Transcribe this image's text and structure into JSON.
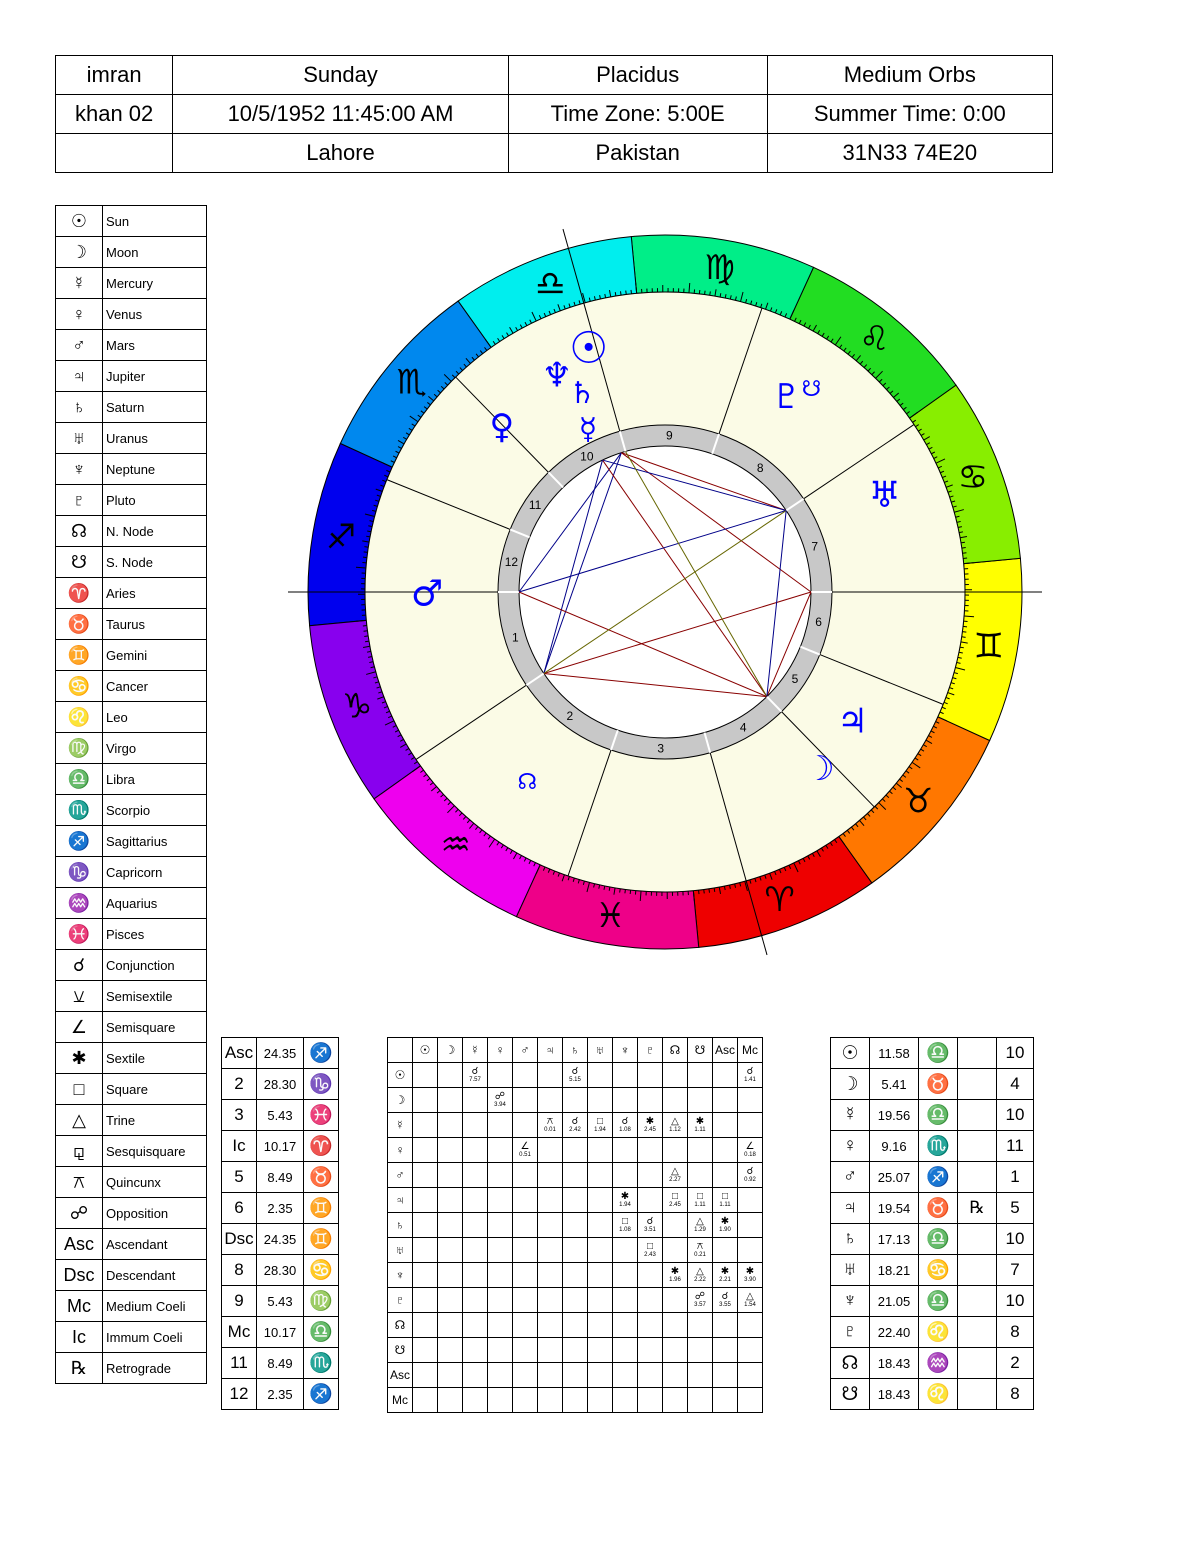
{
  "header": {
    "rows": [
      [
        "imran",
        "Sunday",
        "Placidus",
        "Medium Orbs"
      ],
      [
        "khan 02",
        "10/5/1952 11:45:00 AM",
        "Time Zone: 5:00E",
        "Summer Time: 0:00"
      ],
      [
        "",
        "Lahore",
        "Pakistan",
        "31N33 74E20"
      ]
    ]
  },
  "legend": [
    {
      "glyph": "☉",
      "label": "Sun"
    },
    {
      "glyph": "☽",
      "label": "Moon"
    },
    {
      "glyph": "☿",
      "label": "Mercury"
    },
    {
      "glyph": "♀",
      "label": "Venus"
    },
    {
      "glyph": "♂",
      "label": "Mars"
    },
    {
      "glyph": "♃",
      "label": "Jupiter"
    },
    {
      "glyph": "♄",
      "label": "Saturn"
    },
    {
      "glyph": "♅",
      "label": "Uranus"
    },
    {
      "glyph": "♆",
      "label": "Neptune"
    },
    {
      "glyph": "♇",
      "label": "Pluto"
    },
    {
      "glyph": "☊",
      "label": "N. Node"
    },
    {
      "glyph": "☋",
      "label": "S. Node"
    },
    {
      "glyph": "♈",
      "label": "Aries"
    },
    {
      "glyph": "♉",
      "label": "Taurus"
    },
    {
      "glyph": "♊",
      "label": "Gemini"
    },
    {
      "glyph": "♋",
      "label": "Cancer"
    },
    {
      "glyph": "♌",
      "label": "Leo"
    },
    {
      "glyph": "♍",
      "label": "Virgo"
    },
    {
      "glyph": "♎",
      "label": "Libra"
    },
    {
      "glyph": "♏",
      "label": "Scorpio"
    },
    {
      "glyph": "♐",
      "label": "Sagittarius"
    },
    {
      "glyph": "♑",
      "label": "Capricorn"
    },
    {
      "glyph": "♒",
      "label": "Aquarius"
    },
    {
      "glyph": "♓",
      "label": "Pisces"
    },
    {
      "glyph": "☌",
      "label": "Conjunction"
    },
    {
      "glyph": "⚺",
      "label": "Semisextile"
    },
    {
      "glyph": "∠",
      "label": "Semisquare"
    },
    {
      "glyph": "✱",
      "label": "Sextile"
    },
    {
      "glyph": "□",
      "label": "Square"
    },
    {
      "glyph": "△",
      "label": "Trine"
    },
    {
      "glyph": "⚼",
      "label": "Sesquisquare"
    },
    {
      "glyph": "⚻",
      "label": "Quincunx"
    },
    {
      "glyph": "☍",
      "label": "Opposition"
    },
    {
      "glyph": "Asc",
      "label": "Ascendant"
    },
    {
      "glyph": "Dsc",
      "label": "Descendant"
    },
    {
      "glyph": "Mc",
      "label": "Medium Coeli"
    },
    {
      "glyph": "Ic",
      "label": "Immum Coeli"
    },
    {
      "glyph": "℞",
      "label": "Retrograde"
    }
  ],
  "houses": [
    {
      "h": "Asc",
      "deg": "24.35",
      "sign": "♐"
    },
    {
      "h": "2",
      "deg": "28.30",
      "sign": "♑"
    },
    {
      "h": "3",
      "deg": "5.43",
      "sign": "♓"
    },
    {
      "h": "Ic",
      "deg": "10.17",
      "sign": "♈"
    },
    {
      "h": "5",
      "deg": "8.49",
      "sign": "♉"
    },
    {
      "h": "6",
      "deg": "2.35",
      "sign": "♊"
    },
    {
      "h": "Dsc",
      "deg": "24.35",
      "sign": "♊"
    },
    {
      "h": "8",
      "deg": "28.30",
      "sign": "♋"
    },
    {
      "h": "9",
      "deg": "5.43",
      "sign": "♍"
    },
    {
      "h": "Mc",
      "deg": "10.17",
      "sign": "♎"
    },
    {
      "h": "11",
      "deg": "8.49",
      "sign": "♏"
    },
    {
      "h": "12",
      "deg": "2.35",
      "sign": "♐"
    }
  ],
  "aspect_grid": {
    "columns": [
      "☉",
      "☽",
      "☿",
      "♀",
      "♂",
      "♃",
      "♄",
      "♅",
      "♆",
      "♇",
      "☊",
      "☋",
      "Asc",
      "Mc"
    ],
    "rows": [
      "☉",
      "☽",
      "☿",
      "♀",
      "♂",
      "♃",
      "♄",
      "♅",
      "♆",
      "♇",
      "☊",
      "☋",
      "Asc",
      "Mc"
    ],
    "cells": [
      {
        "r": 0,
        "c": 2,
        "g": "☌",
        "o": "7.57"
      },
      {
        "r": 0,
        "c": 6,
        "g": "☌",
        "o": "5.15"
      },
      {
        "r": 0,
        "c": 13,
        "g": "☌",
        "o": "1.41"
      },
      {
        "r": 1,
        "c": 3,
        "g": "☍",
        "o": "3.94"
      },
      {
        "r": 2,
        "c": 5,
        "g": "⚻",
        "o": "0.01"
      },
      {
        "r": 2,
        "c": 6,
        "g": "☌",
        "o": "2.42"
      },
      {
        "r": 2,
        "c": 7,
        "g": "□",
        "o": "1.94"
      },
      {
        "r": 2,
        "c": 8,
        "g": "☌",
        "o": "1.08"
      },
      {
        "r": 2,
        "c": 9,
        "g": "✱",
        "o": "2.45"
      },
      {
        "r": 2,
        "c": 10,
        "g": "△",
        "o": "1.12"
      },
      {
        "r": 2,
        "c": 11,
        "g": "✱",
        "o": "1.11"
      },
      {
        "r": 3,
        "c": 4,
        "g": "∠",
        "o": "0.51"
      },
      {
        "r": 3,
        "c": 13,
        "g": "∠",
        "o": "0.18"
      },
      {
        "r": 4,
        "c": 10,
        "g": "△",
        "o": "2.27"
      },
      {
        "r": 4,
        "c": 13,
        "g": "☌",
        "o": "0.92"
      },
      {
        "r": 5,
        "c": 8,
        "g": "✱",
        "o": "1.94"
      },
      {
        "r": 5,
        "c": 10,
        "g": "□",
        "o": "2.45"
      },
      {
        "r": 5,
        "c": 11,
        "g": "□",
        "o": "1.11"
      },
      {
        "r": 5,
        "c": 12,
        "g": "□",
        "o": "1.11"
      },
      {
        "r": 6,
        "c": 8,
        "g": "□",
        "o": "1.08"
      },
      {
        "r": 6,
        "c": 9,
        "g": "☌",
        "o": "3.51"
      },
      {
        "r": 6,
        "c": 11,
        "g": "△",
        "o": "1.29"
      },
      {
        "r": 6,
        "c": 12,
        "g": "✱",
        "o": "1.90"
      },
      {
        "r": 7,
        "c": 9,
        "g": "□",
        "o": "2.43"
      },
      {
        "r": 7,
        "c": 11,
        "g": "⚻",
        "o": "0.21"
      },
      {
        "r": 8,
        "c": 10,
        "g": "✱",
        "o": "1.96"
      },
      {
        "r": 8,
        "c": 11,
        "g": "△",
        "o": "2.22"
      },
      {
        "r": 8,
        "c": 12,
        "g": "✱",
        "o": "2.21"
      },
      {
        "r": 8,
        "c": 13,
        "g": "✱",
        "o": "3.90"
      },
      {
        "r": 9,
        "c": 11,
        "g": "☍",
        "o": "3.57"
      },
      {
        "r": 9,
        "c": 12,
        "g": "☌",
        "o": "3.55"
      },
      {
        "r": 9,
        "c": 13,
        "g": "△",
        "o": "1.54"
      }
    ]
  },
  "positions": [
    {
      "g": "☉",
      "deg": "11.58",
      "sign": "♎",
      "r": "",
      "house": "10"
    },
    {
      "g": "☽",
      "deg": "5.41",
      "sign": "♉",
      "r": "",
      "house": "4"
    },
    {
      "g": "☿",
      "deg": "19.56",
      "sign": "♎",
      "r": "",
      "house": "10"
    },
    {
      "g": "♀",
      "deg": "9.16",
      "sign": "♏",
      "r": "",
      "house": "11"
    },
    {
      "g": "♂",
      "deg": "25.07",
      "sign": "♐",
      "r": "",
      "house": "1"
    },
    {
      "g": "♃",
      "deg": "19.54",
      "sign": "♉",
      "r": "℞",
      "house": "5"
    },
    {
      "g": "♄",
      "deg": "17.13",
      "sign": "♎",
      "r": "",
      "house": "10"
    },
    {
      "g": "♅",
      "deg": "18.21",
      "sign": "♋",
      "r": "",
      "house": "7"
    },
    {
      "g": "♆",
      "deg": "21.05",
      "sign": "♎",
      "r": "",
      "house": "10"
    },
    {
      "g": "♇",
      "deg": "22.40",
      "sign": "♌",
      "r": "",
      "house": "8"
    },
    {
      "g": "☊",
      "deg": "18.43",
      "sign": "♒",
      "r": "",
      "house": "2"
    },
    {
      "g": "☋",
      "deg": "18.43",
      "sign": "♌",
      "r": "",
      "house": "8"
    }
  ],
  "wheel": {
    "ascendant_longitude": 264.58,
    "zodiac": [
      {
        "glyph": "♈",
        "color": "#ee0000"
      },
      {
        "glyph": "♉",
        "color": "#ff7700"
      },
      {
        "glyph": "♊",
        "color": "#ffff00"
      },
      {
        "glyph": "♋",
        "color": "#88ee00"
      },
      {
        "glyph": "♌",
        "color": "#22dd22"
      },
      {
        "glyph": "♍",
        "color": "#00ee88"
      },
      {
        "glyph": "♎",
        "color": "#00eeee"
      },
      {
        "glyph": "♏",
        "color": "#0088ee"
      },
      {
        "glyph": "♐",
        "color": "#0000ee"
      },
      {
        "glyph": "♑",
        "color": "#8800ee"
      },
      {
        "glyph": "♒",
        "color": "#ee00ee"
      },
      {
        "glyph": "♓",
        "color": "#ee0088"
      }
    ],
    "house_cusps": [
      {
        "n": "1",
        "lon": 264.58
      },
      {
        "n": "2",
        "lon": 298.5
      },
      {
        "n": "3",
        "lon": 335.72
      },
      {
        "n": "4",
        "lon": 10.28
      },
      {
        "n": "5",
        "lon": 38.82
      },
      {
        "n": "6",
        "lon": 62.58
      },
      {
        "n": "7",
        "lon": 84.58
      },
      {
        "n": "8",
        "lon": 118.5
      },
      {
        "n": "9",
        "lon": 155.72
      },
      {
        "n": "10",
        "lon": 190.28
      },
      {
        "n": "11",
        "lon": 218.82
      },
      {
        "n": "12",
        "lon": 242.58
      }
    ],
    "planets": [
      {
        "g": "☉",
        "lon": 191.97,
        "size": 44
      },
      {
        "g": "☽",
        "lon": 35.68,
        "size": 34
      },
      {
        "g": "☿",
        "lon": 199.93,
        "size": 30
      },
      {
        "g": "♀",
        "lon": 219.27,
        "size": 34
      },
      {
        "g": "♂",
        "lon": 265.12,
        "size": 36
      },
      {
        "g": "♃",
        "lon": 49.9,
        "size": 34
      },
      {
        "g": "♄",
        "lon": 197.22,
        "size": 30
      },
      {
        "g": "♅",
        "lon": 108.35,
        "size": 36
      },
      {
        "g": "♆",
        "lon": 201.08,
        "size": 34
      },
      {
        "g": "♇",
        "lon": 142.67,
        "size": 34
      },
      {
        "g": "☊",
        "lon": 318.72,
        "size": 22
      },
      {
        "g": "☋",
        "lon": 138.72,
        "size": 22
      }
    ],
    "aspect_lines": [
      {
        "a": 191.97,
        "b": 264.58,
        "color": "#000088"
      },
      {
        "a": 191.97,
        "b": 298.5,
        "color": "#000088"
      },
      {
        "a": 191.97,
        "b": 118.5,
        "color": "#880000"
      },
      {
        "a": 191.97,
        "b": 84.58,
        "color": "#880000"
      },
      {
        "a": 199.93,
        "b": 118.5,
        "color": "#000088"
      },
      {
        "a": 199.93,
        "b": 38.82,
        "color": "#880000"
      },
      {
        "a": 199.93,
        "b": 298.5,
        "color": "#000088"
      },
      {
        "a": 264.58,
        "b": 118.5,
        "color": "#000088"
      },
      {
        "a": 264.58,
        "b": 38.82,
        "color": "#880000"
      },
      {
        "a": 298.5,
        "b": 84.58,
        "color": "#880000"
      },
      {
        "a": 298.5,
        "b": 38.82,
        "color": "#880000"
      },
      {
        "a": 190.28,
        "b": 38.82,
        "color": "#666600"
      },
      {
        "a": 118.5,
        "b": 298.5,
        "color": "#666600"
      },
      {
        "a": 84.58,
        "b": 38.82,
        "color": "#880000"
      },
      {
        "a": 118.5,
        "b": 38.82,
        "color": "#000088"
      }
    ],
    "colors": {
      "planet": "#0000ff",
      "house_ring": "#c8c8c8",
      "inner_fill": "#fbfbe6"
    }
  }
}
